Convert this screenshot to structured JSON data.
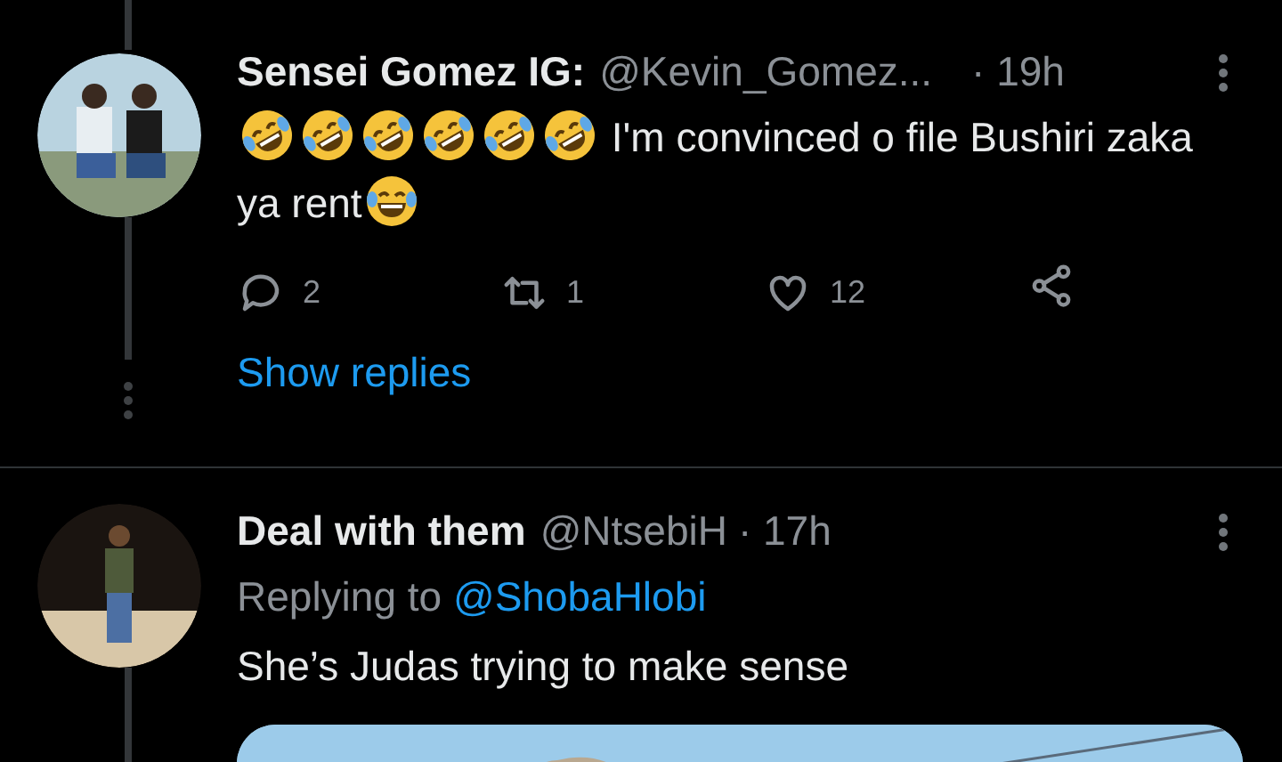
{
  "tweets": [
    {
      "name": "Sensei Gomez IG:",
      "handle": "@Kevin_Gomez...",
      "time": "· 19h",
      "body": [
        {
          "kind": "rofl-emoji"
        },
        {
          "kind": "rofl-emoji"
        },
        {
          "kind": "rofl-emoji"
        },
        {
          "kind": "rofl-emoji"
        },
        {
          "kind": "rofl-emoji"
        },
        {
          "kind": "rofl-emoji"
        },
        {
          "kind": "text",
          "text": " I'm convinced o file Bushiri zaka ya rent"
        },
        {
          "kind": "joy-emoji"
        }
      ],
      "actions": {
        "replies": "2",
        "retweets": "1",
        "likes": "12"
      },
      "show_replies": "Show replies"
    },
    {
      "name": "Deal with them",
      "handle": "@NtsebiH",
      "time": "· 17h",
      "replying_label": "Replying to",
      "replying_to": "@ShobaHlobi",
      "body": [
        {
          "kind": "text",
          "text": "She’s Judas trying to make sense"
        }
      ],
      "media": {
        "kind": "picture"
      }
    }
  ]
}
